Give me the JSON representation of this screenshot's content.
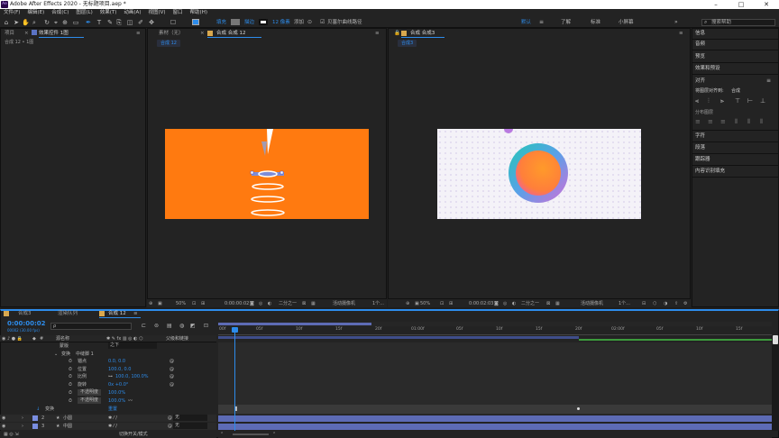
{
  "window": {
    "title": "Adobe After Effects 2020 - 无标题项目.aep *",
    "app_badge": "Ae",
    "minimize": "–",
    "maximize": "□",
    "close": "✕"
  },
  "menu": [
    "文件(F)",
    "编辑(E)",
    "合成(C)",
    "图层(L)",
    "效果(T)",
    "动画(A)",
    "视图(V)",
    "窗口",
    "帮助(H)"
  ],
  "toolbar": {
    "fill_label": "填充",
    "stroke_label": "描边",
    "stroke_value": "12 像素",
    "add_label": "添加",
    "bezier_label": "贝塞尔曲线路径",
    "workspaces": [
      "默认",
      "了解",
      "标准",
      "小屏幕"
    ],
    "search_placeholder": "搜索帮助"
  },
  "project_panel": {
    "tabs": [
      "项目",
      "效果控件 1图"
    ],
    "subtitle": "合成 12 • 1图"
  },
  "viewer_left": {
    "tabs": [
      "素材（无）",
      "合成 合成 12"
    ],
    "comp_chip": "合成 12",
    "zoom": "50%",
    "timecode": "0:00:00:02",
    "resolution": "二分之一",
    "camera": "活动摄像机",
    "views": "1个..."
  },
  "viewer_right": {
    "tabs": [
      "合成 合成3"
    ],
    "comp_chip": "合成3",
    "zoom": "50%",
    "timecode": "0:00:02:03",
    "resolution": "二分之一",
    "camera": "活动摄像机",
    "views": "1个..."
  },
  "right_panel": {
    "items": [
      "信息",
      "音频",
      "预览",
      "效果和预设"
    ],
    "align_title": "对齐",
    "align_to_label": "将图层对齐到:",
    "align_to_value": "合成",
    "distribute_label": "分布图层",
    "items2": [
      "字符",
      "段落",
      "跟踪器",
      "内容识别填充"
    ]
  },
  "timeline": {
    "tabs": [
      "合成3",
      "渲染队列",
      "合成 12"
    ],
    "timecode": "0:00:00:02",
    "frames": "00002 (30.00 fps)",
    "search_placeholder": "ρ",
    "col_headers": {
      "source_name": "源名称",
      "parent": "父级和链接"
    },
    "rows": [
      {
        "label": "蒙版",
        "value": "",
        "mode": "之下"
      },
      {
        "label": "变换",
        "value": "",
        "extra": "中缝脚 1"
      },
      {
        "label": "锚点",
        "value": "0.0, 0.0"
      },
      {
        "label": "位置",
        "value": "100.0, 0.0"
      },
      {
        "label": "比例",
        "value": "100.0, 100.0%"
      },
      {
        "label": "旋转",
        "value": "0x +0.0°"
      },
      {
        "label": "不透明度",
        "value": "100.0%"
      },
      {
        "label": "不透明度",
        "value": "100.0%"
      },
      {
        "label": "变换",
        "value": "重置"
      }
    ],
    "layers": [
      {
        "num": "2",
        "name": "小圆",
        "parent": "无"
      },
      {
        "num": "3",
        "name": "中圆",
        "parent": "无"
      }
    ],
    "footer": "切换开关/模式",
    "ruler": [
      "00f",
      "05f",
      "10f",
      "15f",
      "20f",
      "01:00f",
      "05f",
      "10f",
      "15f",
      "20f",
      "02:00f",
      "05f",
      "10f",
      "15f"
    ]
  },
  "colors": {
    "accent": "#2d8ceb",
    "orange": "#ff7a10",
    "layer_bar": "#5d6bb5"
  }
}
